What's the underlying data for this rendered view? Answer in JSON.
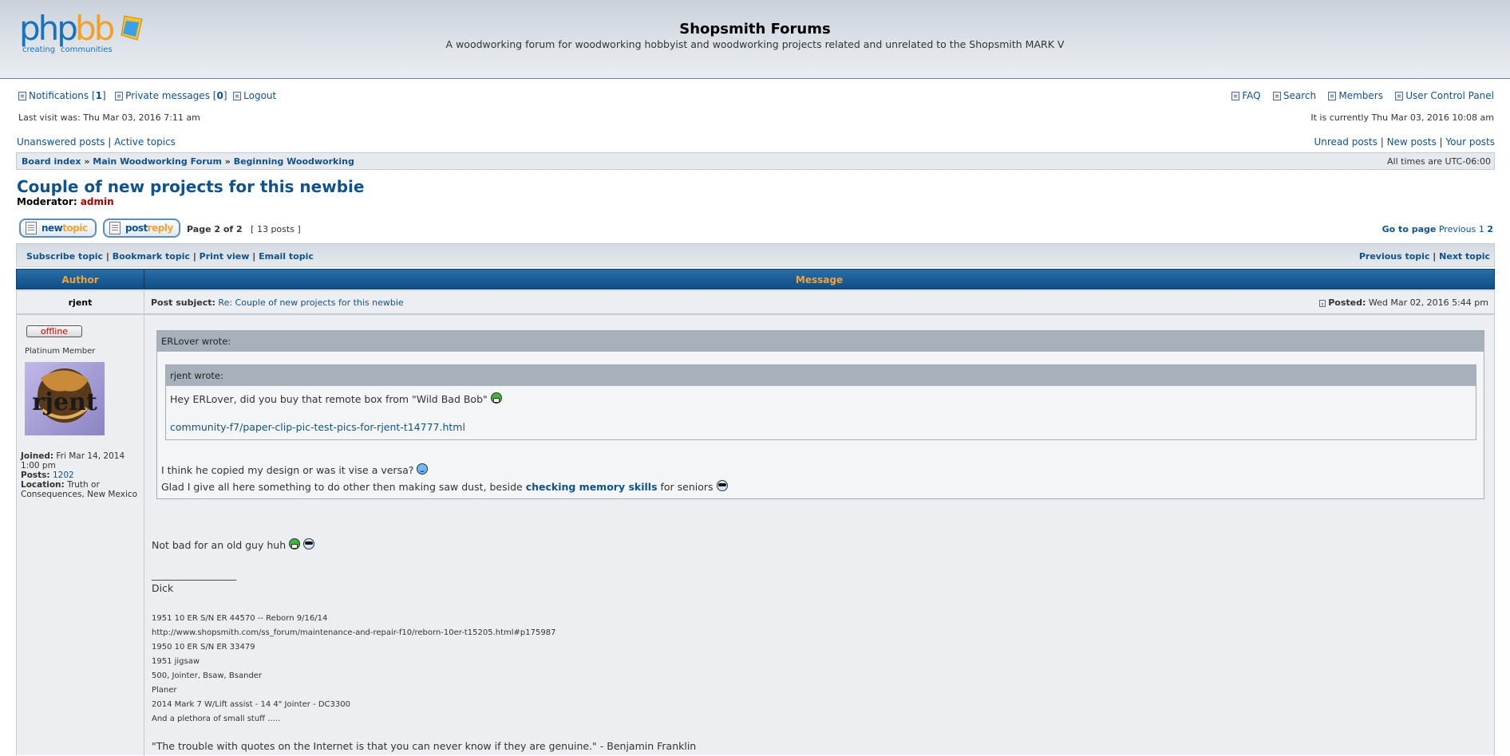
{
  "site": {
    "title": "Shopsmith Forums",
    "description": "A woodworking forum for woodworking hobbyist and woodworking projects related and unrelated to the Shopsmith MARK V",
    "logo_text": "phpbb",
    "logo_tagline": "creating communities"
  },
  "usernav": {
    "notifications_label": "Notifications",
    "notifications_count": "1",
    "pm_label": "Private messages",
    "pm_count": "0",
    "logout": "Logout",
    "faq": "FAQ",
    "search": "Search",
    "members": "Members",
    "ucp": "User Control Panel"
  },
  "visit": {
    "last_visit": "Last visit was: Thu Mar 03, 2016 7:11 am",
    "current_time": "It is currently Thu Mar 03, 2016 10:08 am"
  },
  "quicklinks": {
    "unanswered": "Unanswered posts",
    "active": "Active topics",
    "unread": "Unread posts",
    "new_posts": "New posts",
    "your_posts": "Your posts"
  },
  "breadcrumb": {
    "items": [
      "Board index",
      "Main Woodworking Forum",
      "Beginning Woodworking"
    ],
    "timezone": "All times are UTC-06:00"
  },
  "topic": {
    "title": "Couple of new projects for this newbie",
    "moderator_label": "Moderator:",
    "moderator": "admin"
  },
  "buttons": {
    "new_topic_a": "new",
    "new_topic_b": "topic",
    "post_reply_a": "post",
    "post_reply_b": "reply"
  },
  "pagination": {
    "page_info": "Page 2 of 2",
    "post_count": "[ 13 posts ]",
    "goto": "Go to page",
    "previous": "Previous",
    "page1": "1",
    "page2": "2"
  },
  "topic_actions": {
    "subscribe": "Subscribe topic",
    "bookmark": "Bookmark topic",
    "print": "Print view",
    "email": "Email topic",
    "prev_topic": "Previous topic",
    "next_topic": "Next topic"
  },
  "table_head": {
    "author": "Author",
    "message": "Message"
  },
  "post": {
    "author": "rjent",
    "subject_label": "Post subject:",
    "subject": "Re: Couple of new projects for this newbie",
    "posted_label": "Posted:",
    "posted": "Wed Mar 02, 2016 5:44 pm",
    "status": "offline",
    "rank": "Platinum Member",
    "avatar_text": "rjent",
    "joined_label": "Joined:",
    "joined": "Fri Mar 14, 2014 1:00 pm",
    "posts_label": "Posts:",
    "posts": "1202",
    "location_label": "Location:",
    "location": "Truth or Consequences, New Mexico",
    "outer_quote_head": "ERLover wrote:",
    "inner_quote_head": "rjent wrote:",
    "inner_quote_line1": "Hey ERLover, did you buy that remote box from \"Wild Bad Bob\"",
    "inner_quote_link": "community-f7/paper-clip-pic-test-pics-for-rjent-t14777.html",
    "outer_line1": "I think he copied my design or was it vise a versa?",
    "outer_line2_a": "Glad I give all here something to do other then making saw dust, beside",
    "outer_line2_bold": "checking memory skills",
    "outer_line2_b": "for seniors",
    "body_line": "Not bad for an old guy huh",
    "sig_rule": "_________________",
    "sig_name": "Dick",
    "sig_lines": [
      "1951 10 ER S/N ER 44570 -- Reborn 9/16/14",
      "http://www.shopsmith.com/ss_forum/maintenance-and-repair-f10/reborn-10er-t15205.html#p175987",
      "1950 10 ER S/N ER 33479",
      "1951 jigsaw",
      "500, Jointer, Bsaw, Bsander",
      "Planer",
      "2014 Mark 7 W/Lift assist - 14 4\" Jointer - DC3300",
      "And a plethora of small stuff ....."
    ],
    "sig_quote": "\"The trouble with quotes on the Internet is that you can never know if they are genuine.\" - Benjamin Franklin"
  },
  "colors": {
    "link": "#105289",
    "header_blue": "#0f4d85",
    "header_orange": "#f0a33a",
    "moderator_red": "#aa0000"
  },
  "icons": [
    "notifications-icon",
    "pm-icon",
    "logout-icon",
    "faq-icon",
    "search-icon",
    "members-icon",
    "ucp-icon",
    "post-icon",
    "grin-smiley",
    "wink-smiley",
    "cool-smiley"
  ]
}
